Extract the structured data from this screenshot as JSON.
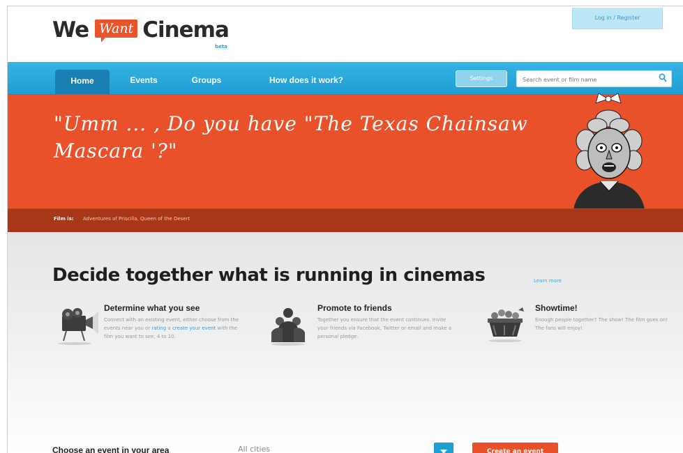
{
  "header": {
    "logo": {
      "part1": "We",
      "part2": "Want",
      "part3": "Cinema",
      "beta": "beta"
    },
    "login_label": "Log in / Register"
  },
  "nav": {
    "items": [
      {
        "label": "Home",
        "active": true
      },
      {
        "label": "Events",
        "active": false
      },
      {
        "label": "Groups",
        "active": false
      },
      {
        "label": "How does it work?",
        "active": false
      }
    ],
    "settings_label": "Settings",
    "search_placeholder": "Search event or film name",
    "search_icon": "search-icon"
  },
  "banner": {
    "quote": "\"Umm ... , Do you have \"The Texas Chainsaw Mascara '?\"",
    "credit_label": "Film is:",
    "credit_text": "Adventures of Priscilla, Queen of the Desert"
  },
  "main": {
    "headline": "Decide together what is running in cinemas",
    "learn_more": "Learn more",
    "features": [
      {
        "icon": "projector-icon",
        "title": "Determine what you see",
        "desc_1": "Connect with an existing event, either choose from the events near you or",
        "link_1": "rating",
        "desc_2": "a",
        "link_2": "create your event",
        "desc_3": "with the film you want to see, 4 to 10."
      },
      {
        "icon": "people-icon",
        "title": "Promote to friends",
        "desc_1": "Together you ensure that the event continues. Invite your friends via Facebook, Twitter or email and make a personal pledge."
      },
      {
        "icon": "popcorn-icon",
        "title": "Showtime!",
        "desc_1": "Enough people together? The show! The film goes on! The fans will enjoy!"
      }
    ],
    "choose_label": "Choose an event in your area",
    "city_value": "All cities",
    "create_label": "Create an event"
  },
  "colors": {
    "brand_orange": "#e8512a",
    "nav_blue": "#1f9ed3"
  }
}
